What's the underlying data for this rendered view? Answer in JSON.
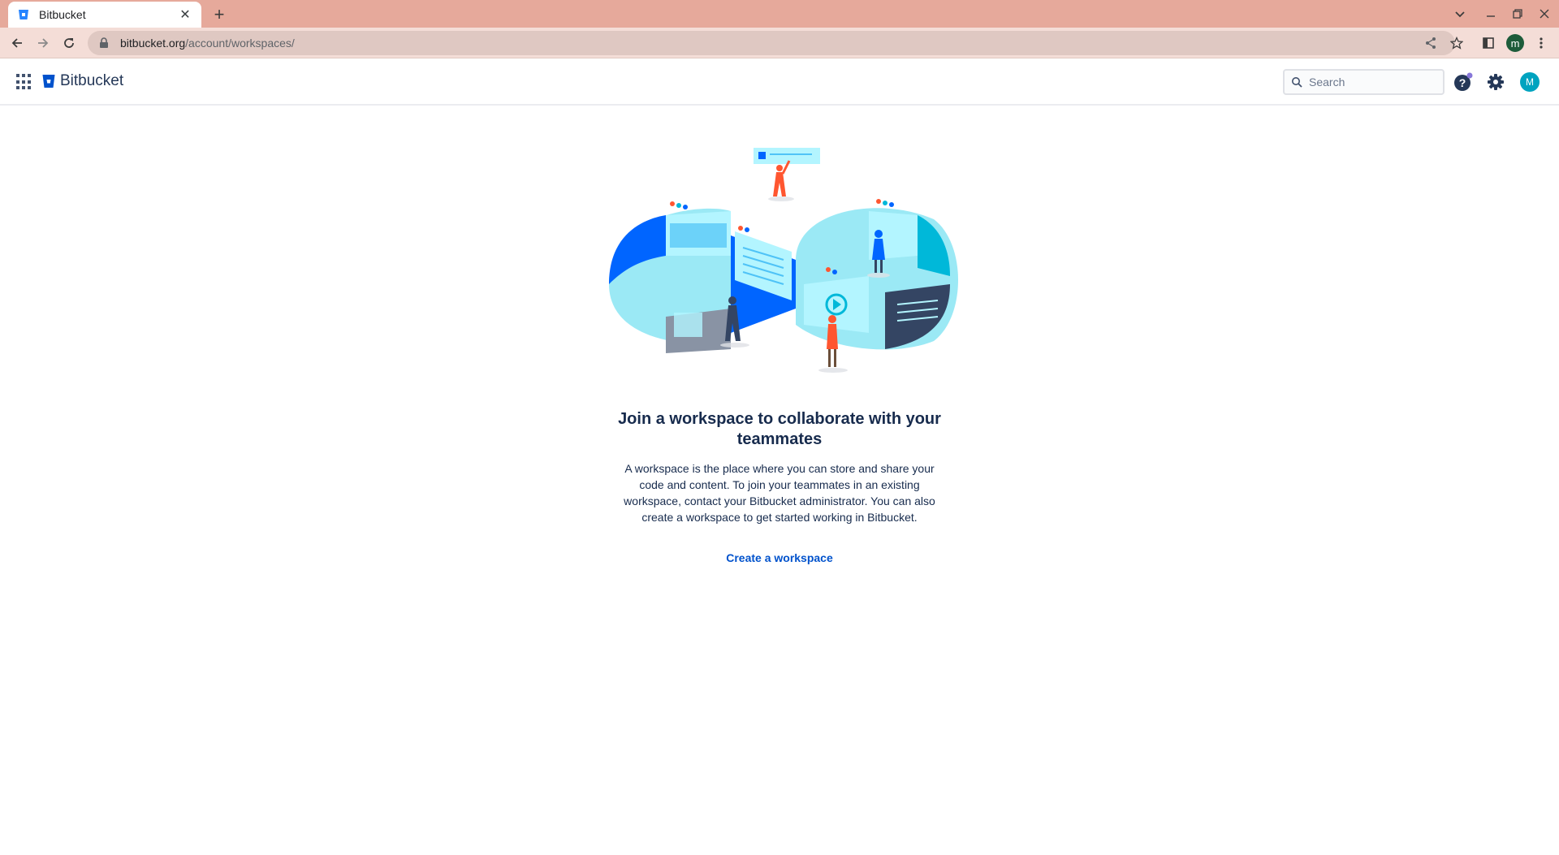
{
  "browser": {
    "tab_title": "Bitbucket",
    "url_host": "bitbucket.org",
    "url_path": "/account/workspaces/",
    "profile_initial": "m"
  },
  "header": {
    "product_name": "Bitbucket",
    "search_placeholder": "Search",
    "avatar_initial": "M"
  },
  "empty_state": {
    "headline": "Join a workspace to collaborate with your teammates",
    "description": "A workspace is the place where you can store and share your code and content. To join your teammates in an existing workspace, contact your Bitbucket administrator. You can also create a workspace to get started working in Bitbucket.",
    "cta_label": "Create a workspace"
  },
  "colors": {
    "brand": "#0052cc",
    "chrome_tab_bar": "#e6a99b",
    "avatar": "#00a3bf",
    "text": "#172b4d"
  },
  "icons": [
    "bitbucket-favicon",
    "close-icon",
    "plus-icon",
    "chevron-down-icon",
    "minimize-icon",
    "restore-icon",
    "back-arrow-icon",
    "forward-arrow-icon",
    "reload-icon",
    "lock-icon",
    "share-icon",
    "star-icon",
    "side-panel-icon",
    "kebab-menu-icon",
    "app-switcher-icon",
    "bitbucket-logo",
    "search-icon",
    "help-icon",
    "gear-icon"
  ]
}
